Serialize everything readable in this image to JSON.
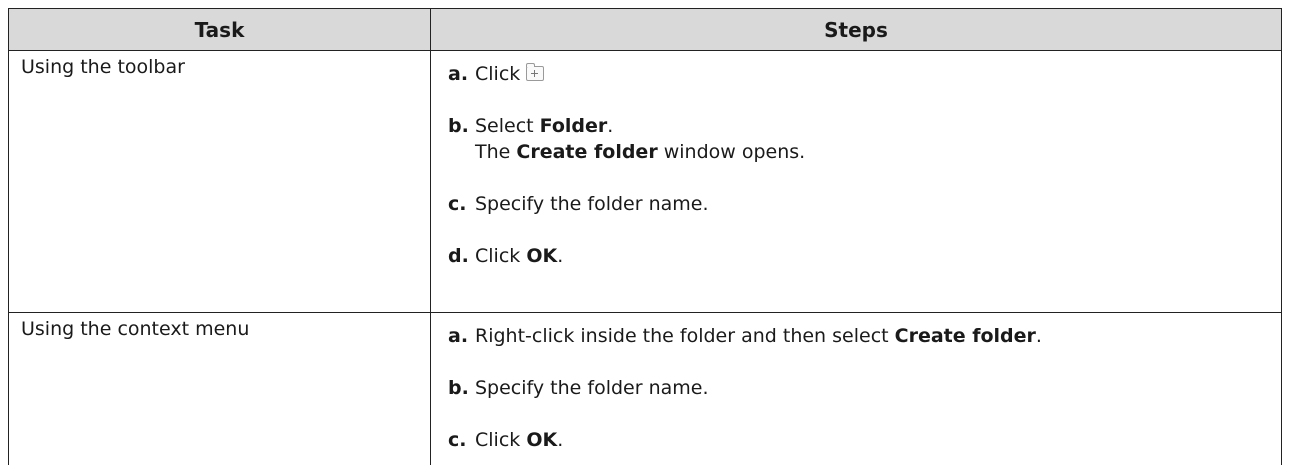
{
  "table": {
    "headers": {
      "task": "Task",
      "steps": "Steps"
    },
    "rows": [
      {
        "task": "Using the toolbar",
        "steps": [
          {
            "letter": "a.",
            "text_before": "Click",
            "icon": "add-folder-icon"
          },
          {
            "letter": "b.",
            "text_before": "Select ",
            "bold": "Folder",
            "text_after": ".",
            "line2_before": "The ",
            "line2_bold": "Create folder",
            "line2_after": " window opens."
          },
          {
            "letter": "c.",
            "text": "Specify the folder name."
          },
          {
            "letter": "d.",
            "text_before": "Click ",
            "bold": "OK",
            "text_after": "."
          }
        ]
      },
      {
        "task": "Using the context menu",
        "steps": [
          {
            "letter": "a.",
            "text_before": "Right-click inside the folder and then select ",
            "bold": "Create folder",
            "text_after": "."
          },
          {
            "letter": "b.",
            "text": "Specify the folder name."
          },
          {
            "letter": "c.",
            "text_before": "Click ",
            "bold": "OK",
            "text_after": "."
          }
        ]
      }
    ]
  }
}
